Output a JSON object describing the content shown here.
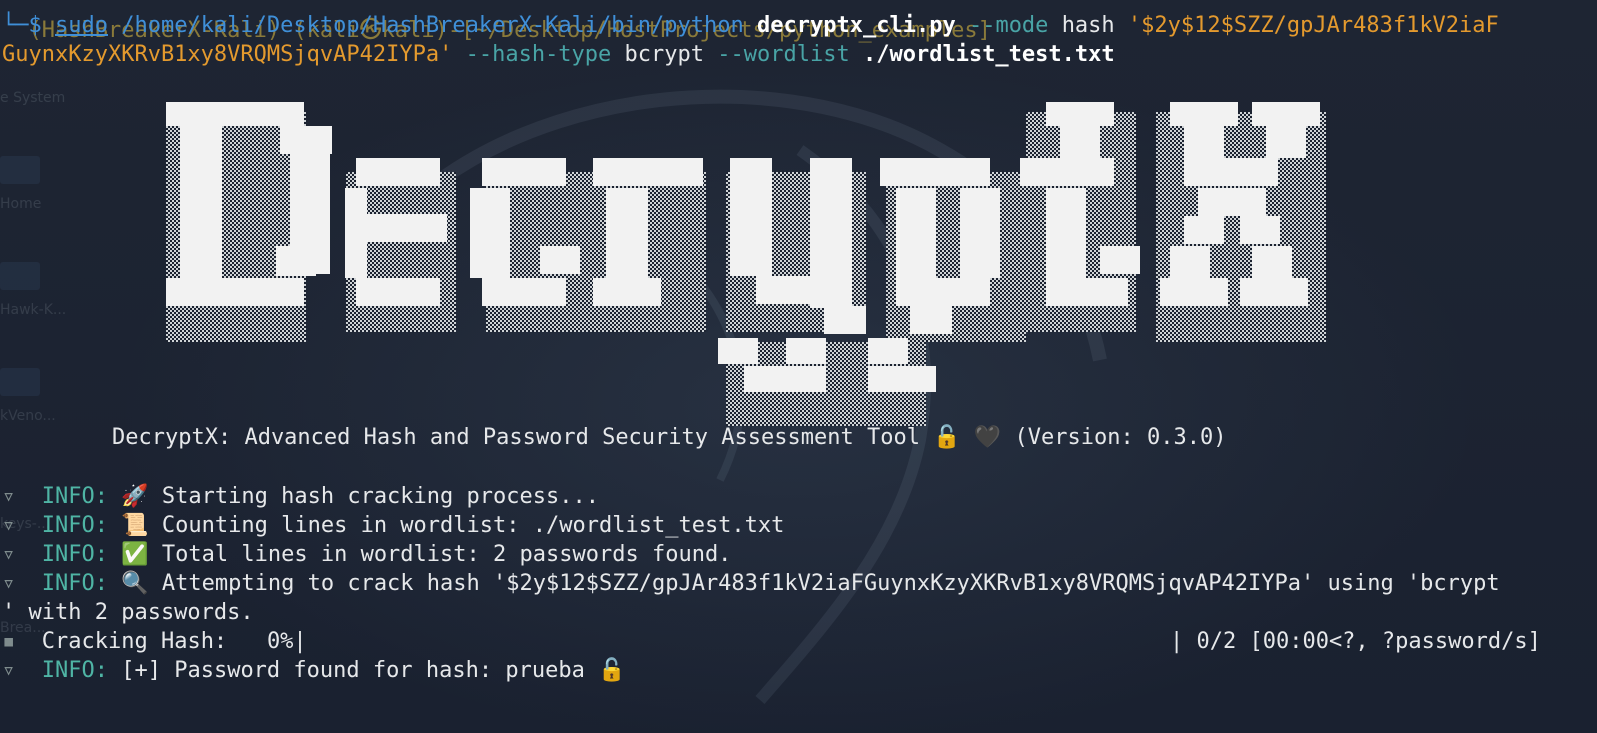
{
  "terminal": {
    "prompt_header": "(HashBreakerX-Kali) (kali㉿kali)-[~/Desktop/HostProjects/python_examples]",
    "prompt_corner": "└─$",
    "command": {
      "sudo": "sudo",
      "python_path": "/home/kali/Desktop/HashBreakerX-Kali/bin/python",
      "script": "decryptx_cli.py",
      "mode_flag": "--mode",
      "mode_value": "hash",
      "hash_arg_part1": "'$2y$12$SZZ/gpJAr483f1kV2iaF",
      "hash_arg_part2": "GuynxKzyXKRvB1xy8VRQMSjqvAP42IYPa'",
      "hash_type_flag": "--hash-type",
      "hash_type_value": "bcrypt",
      "wordlist_flag": "--wordlist",
      "wordlist_value": "./wordlist_test.txt"
    },
    "banner": {
      "art_text": "DecryptX",
      "tool_line": "DecryptX: Advanced Hash and Password Security Assessment Tool",
      "lock_icon": "🔓",
      "heart_icon": "🖤",
      "version": "(Version: 0.3.0)"
    },
    "log": [
      {
        "level": "INFO:",
        "icon": "🚀",
        "message": "Starting hash cracking process..."
      },
      {
        "level": "INFO:",
        "icon": "📜",
        "message": "Counting lines in wordlist: ./wordlist_test.txt"
      },
      {
        "level": "INFO:",
        "icon": "✅",
        "message": "Total lines in wordlist: 2 passwords found."
      },
      {
        "level": "INFO:",
        "icon": "🔍",
        "message": "Attempting to crack hash '$2y$12$SZZ/gpJAr483f1kV2iaFGuynxKzyXKRvB1xy8VRQMSjqvAP42IYPa' using 'bcrypt"
      },
      {
        "continuation": "' with 2 passwords."
      }
    ],
    "progress": {
      "label": "Cracking Hash:",
      "percent": "0%|",
      "fraction": 0,
      "stats": "| 0/2 [00:00<?, ?password/s]"
    },
    "final": {
      "level": "INFO:",
      "message": "[+] Password found for hash: prueba",
      "icon": "🔓"
    }
  },
  "desktop_ghost": {
    "items": [
      "e System",
      "Home",
      "Hawk-K...",
      "kVeno...",
      "keys-...",
      "Brea..."
    ]
  },
  "colors": {
    "background": "#1b2230",
    "info": "#4fb5a5",
    "path": "#3f8fd8",
    "string": "#e49a2e",
    "flag": "#49a4a6"
  }
}
